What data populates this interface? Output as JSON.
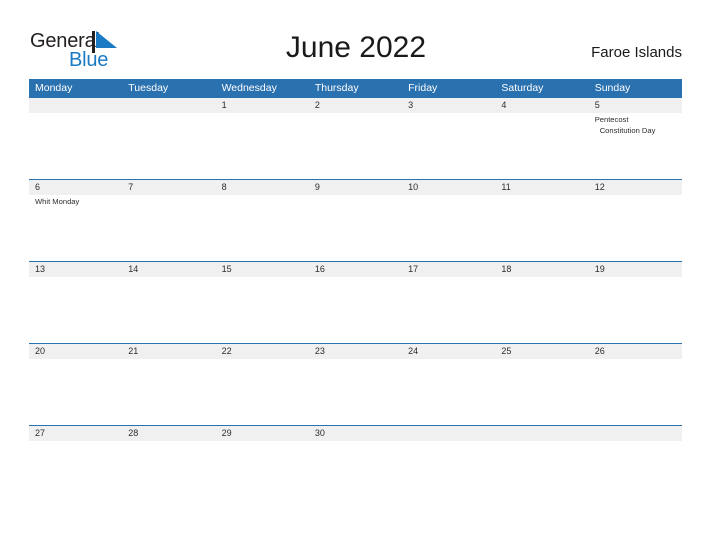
{
  "brand": {
    "word_one": "General",
    "word_two": "Blue",
    "flag_icon": "blue-triangle-flag",
    "accent_color": "#1a7ac4",
    "text_color": "#231f20"
  },
  "header": {
    "title": "June 2022",
    "location": "Faroe Islands"
  },
  "calendar": {
    "header_bg": "#2a71b0",
    "date_band_bg": "#f0f0f0",
    "weekdays": [
      "Monday",
      "Tuesday",
      "Wednesday",
      "Thursday",
      "Friday",
      "Saturday",
      "Sunday"
    ],
    "weeks": [
      {
        "days": [
          {
            "date": "",
            "events": []
          },
          {
            "date": "",
            "events": []
          },
          {
            "date": "1",
            "events": []
          },
          {
            "date": "2",
            "events": []
          },
          {
            "date": "3",
            "events": []
          },
          {
            "date": "4",
            "events": []
          },
          {
            "date": "5",
            "events": [
              {
                "label": "Pentecost",
                "indent": false
              },
              {
                "label": "Constitution Day",
                "indent": true
              }
            ]
          }
        ]
      },
      {
        "days": [
          {
            "date": "6",
            "events": [
              {
                "label": "Whit Monday",
                "indent": false
              }
            ]
          },
          {
            "date": "7",
            "events": []
          },
          {
            "date": "8",
            "events": []
          },
          {
            "date": "9",
            "events": []
          },
          {
            "date": "10",
            "events": []
          },
          {
            "date": "11",
            "events": []
          },
          {
            "date": "12",
            "events": []
          }
        ]
      },
      {
        "days": [
          {
            "date": "13",
            "events": []
          },
          {
            "date": "14",
            "events": []
          },
          {
            "date": "15",
            "events": []
          },
          {
            "date": "16",
            "events": []
          },
          {
            "date": "17",
            "events": []
          },
          {
            "date": "18",
            "events": []
          },
          {
            "date": "19",
            "events": []
          }
        ]
      },
      {
        "days": [
          {
            "date": "20",
            "events": []
          },
          {
            "date": "21",
            "events": []
          },
          {
            "date": "22",
            "events": []
          },
          {
            "date": "23",
            "events": []
          },
          {
            "date": "24",
            "events": []
          },
          {
            "date": "25",
            "events": []
          },
          {
            "date": "26",
            "events": []
          }
        ]
      },
      {
        "days": [
          {
            "date": "27",
            "events": []
          },
          {
            "date": "28",
            "events": []
          },
          {
            "date": "29",
            "events": []
          },
          {
            "date": "30",
            "events": []
          },
          {
            "date": "",
            "events": []
          },
          {
            "date": "",
            "events": []
          },
          {
            "date": "",
            "events": []
          }
        ]
      }
    ]
  }
}
